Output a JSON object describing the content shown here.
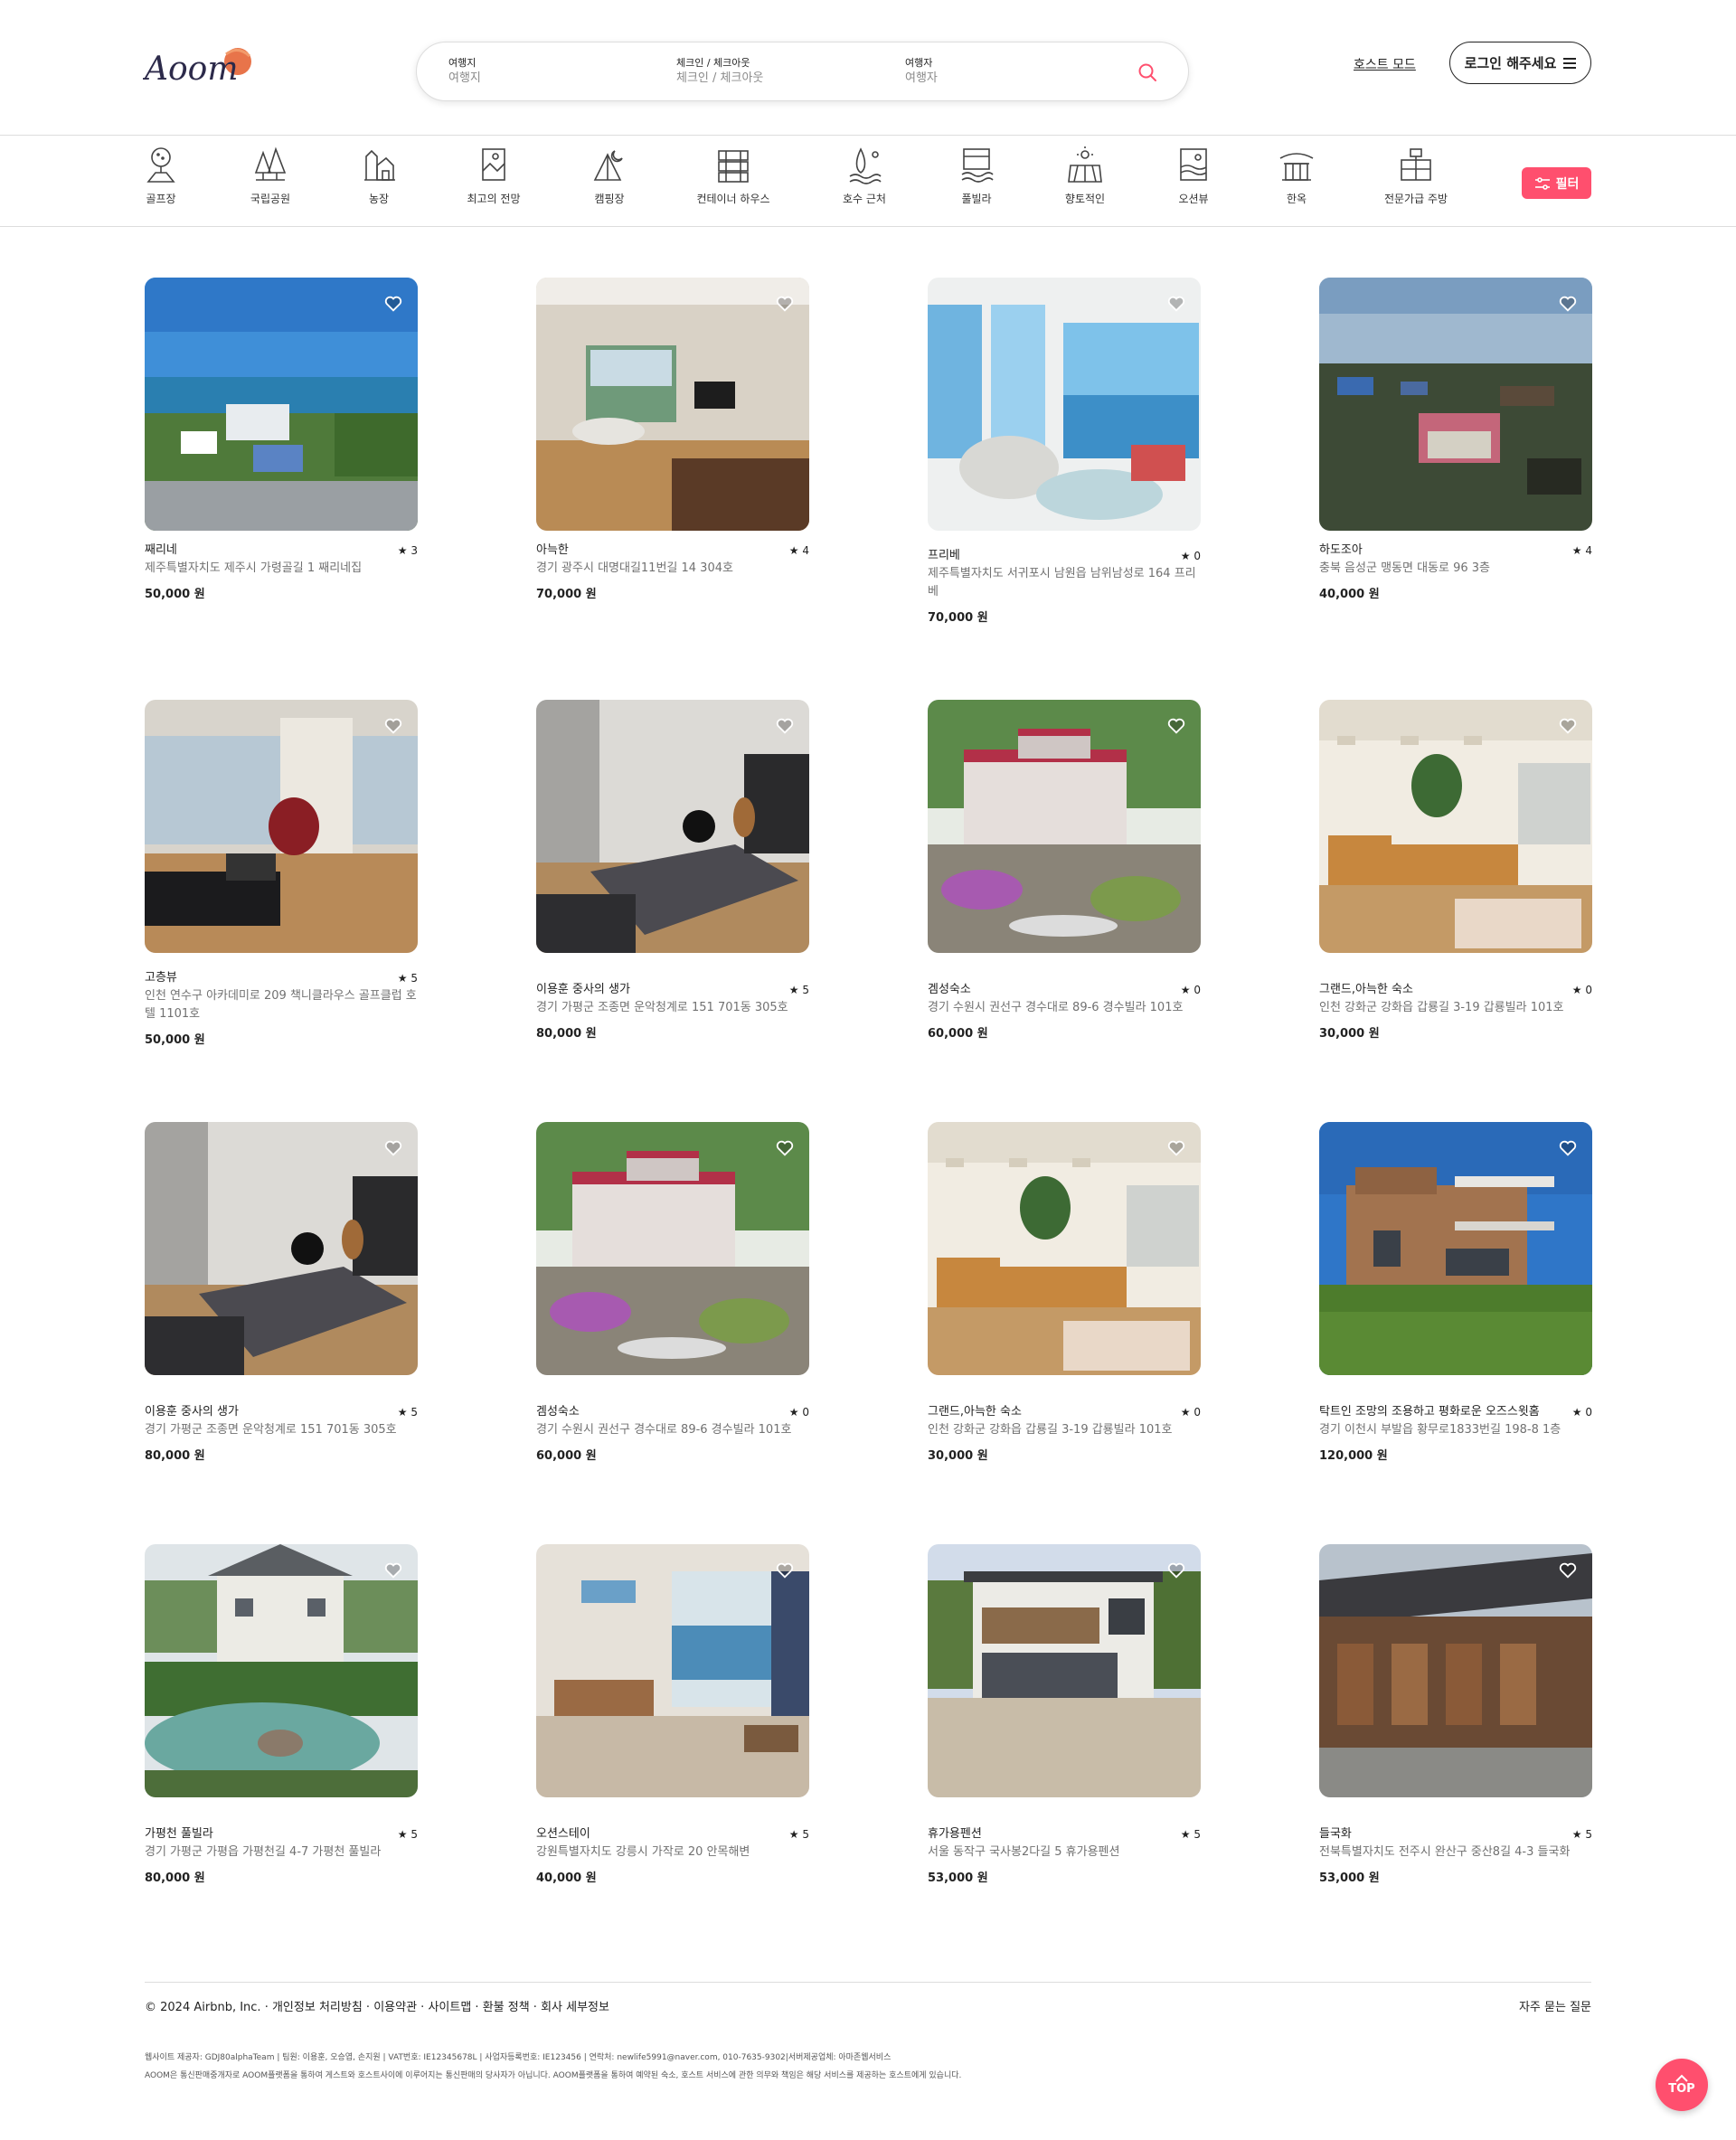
{
  "brand": {
    "logo_text": "Aoom",
    "accent": "#ff4f6e",
    "logo_sun": "#e8744a"
  },
  "search": {
    "where_label": "여행지",
    "where_placeholder": "여행지",
    "dates_label": "체크인 / 체크아웃",
    "dates_placeholder": "체크인 / 체크아웃",
    "guests_label": "여행자",
    "guests_placeholder": "여행자",
    "button_icon": "search-icon"
  },
  "header": {
    "host_mode": "호스트 모드",
    "login": "로그인 해주세요",
    "menu_icon": "menu-icon"
  },
  "categories": [
    {
      "label": "골프장",
      "icon": "golf-icon"
    },
    {
      "label": "국립공원",
      "icon": "national-park-icon"
    },
    {
      "label": "농장",
      "icon": "farm-icon"
    },
    {
      "label": "최고의 전망",
      "icon": "best-view-icon"
    },
    {
      "label": "캠핑장",
      "icon": "camping-icon"
    },
    {
      "label": "컨테이너 하우스",
      "icon": "container-house-icon"
    },
    {
      "label": "호수 근처",
      "icon": "lake-icon"
    },
    {
      "label": "풀빌라",
      "icon": "pool-villa-icon"
    },
    {
      "label": "향토적인",
      "icon": "countryside-icon"
    },
    {
      "label": "오션뷰",
      "icon": "ocean-view-icon"
    },
    {
      "label": "한옥",
      "icon": "hanok-icon"
    },
    {
      "label": "전문가급 주방",
      "icon": "chef-kitchen-icon"
    }
  ],
  "filter": {
    "label": "필터",
    "icon": "sliders-icon"
  },
  "listings": [
    {
      "name": "째리네",
      "rating": "3",
      "address": "제주특별자치도 제주시 가령골길 1 째리네집",
      "price": "50,000 원",
      "photo": "harbor-town"
    },
    {
      "name": "아늑한",
      "rating": "4",
      "address": "경기 광주시 대명대길11번길 14 304호",
      "price": "70,000 원",
      "photo": "living-room"
    },
    {
      "name": "프리베",
      "rating": "0",
      "address": "제주특별자치도 서귀포시 남원읍 남위남성로 164 프리베",
      "price": "70,000 원",
      "photo": "ocean-view-room"
    },
    {
      "name": "하도조아",
      "rating": "4",
      "address": "충북 음성군 맹동면 대동로 96 3층",
      "price": "40,000 원",
      "photo": "aerial-village"
    },
    {
      "name": "고층뷰",
      "rating": "5",
      "address": "인천 연수구 아카데미로 209 책니클라우스 골프클럽 호텔 1101호",
      "price": "50,000 원",
      "photo": "highrise-lounge"
    },
    {
      "name": "이용훈 중사의 생가",
      "rating": "5",
      "address": "경기 가평군 조종면 운악청계로 151 701동 305호",
      "price": "80,000 원",
      "photo": "bedroom"
    },
    {
      "name": "겜성숙소",
      "rating": "0",
      "address": "경기 수원시 권선구 경수대로 89-6 경수빌라 101호",
      "price": "60,000 원",
      "photo": "garden-house"
    },
    {
      "name": "그랜드,아늑한 숙소",
      "rating": "0",
      "address": "인천 강화군 강화읍 갑룡길 3-19 갑룡빌라 101호",
      "price": "30,000 원",
      "photo": "sofa-room"
    },
    {
      "name": "이용훈 중사의 생가",
      "rating": "5",
      "address": "경기 가평군 조종면 운악청계로 151 701동 305호",
      "price": "80,000 원",
      "photo": "bedroom"
    },
    {
      "name": "겜성숙소",
      "rating": "0",
      "address": "경기 수원시 권선구 경수대로 89-6 경수빌라 101호",
      "price": "60,000 원",
      "photo": "garden-house"
    },
    {
      "name": "그랜드,아늑한 숙소",
      "rating": "0",
      "address": "인천 강화군 강화읍 갑룡길 3-19 갑룡빌라 101호",
      "price": "30,000 원",
      "photo": "sofa-room"
    },
    {
      "name": "탁트인 조망의 조용하고 평화로운 오즈스윗홈",
      "rating": "0",
      "address": "경기 이천시 부발읍 황무로1833번길 198-8 1층",
      "price": "120,000 원",
      "photo": "brick-house"
    },
    {
      "name": "가평천 풀빌라",
      "rating": "5",
      "address": "경기 가평군 가평읍 가평천길 4-7 가평천 풀빌라",
      "price": "80,000 원",
      "photo": "pond-villa"
    },
    {
      "name": "오션스테이",
      "rating": "5",
      "address": "강원특별자치도 강릉시 가작로 20 안목해변",
      "price": "40,000 원",
      "photo": "ocean-apartment"
    },
    {
      "name": "휴가용펜션",
      "rating": "5",
      "address": "서울 동작구 국사봉2다길 5 휴가용펜션",
      "price": "53,000 원",
      "photo": "pension"
    },
    {
      "name": "들국화",
      "rating": "5",
      "address": "전북특별자치도 전주시 완산구 중산8길 4-3 들국화",
      "price": "53,000 원",
      "photo": "hanok-house"
    }
  ],
  "footer": {
    "copyright": "© 2024 Airbnb, Inc.",
    "links": [
      "개인정보 처리방침",
      "이용약관",
      "사이트맵",
      "환불 정책",
      "회사 세부정보"
    ],
    "faq": "자주 묻는 질문",
    "info_line1": "웹사이트 제공자: GDJ80alphaTeam | 팀원: 이용훈, 오승엽, 손지원 | VAT번호: IE12345678L | 사업자등록번호: IE123456 | 연락처: newlife5991@naver.com, 010-7635-9302|서버제공업체: 아마존웹서비스",
    "info_line2": "AOOM은 통신판매중개자로 AOOM플랫폼을 통하여 게스트와 호스트사이에 이루어지는 통신판매의 당사자가 아닙니다. AOOM플랫폼을 통하여 예약된 숙소, 호스트 서비스에 관한 의무와 책임은 해당 서비스를 제공하는 호스트에게 있습니다."
  },
  "top_button": "TOP"
}
